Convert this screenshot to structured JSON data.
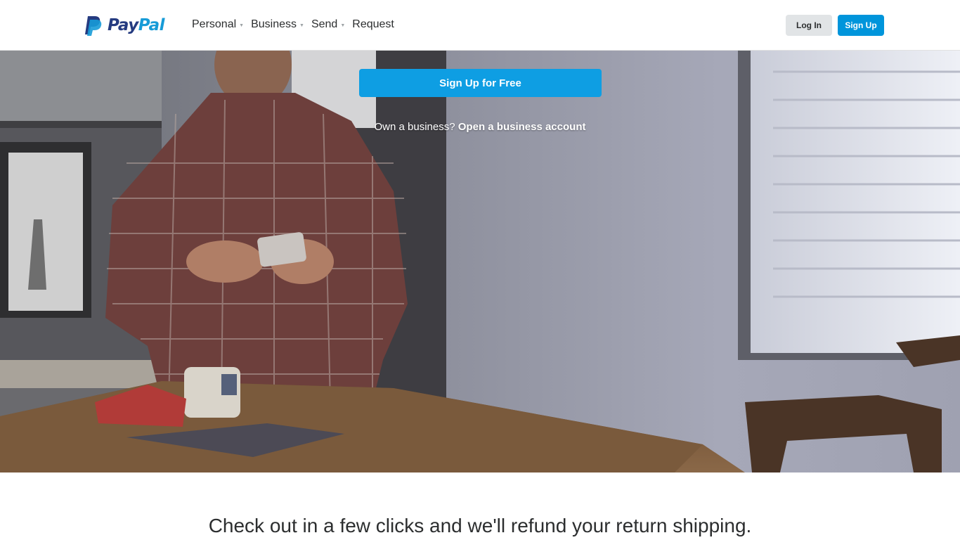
{
  "header": {
    "brand": {
      "pay": "Pay",
      "pal": "Pal"
    },
    "nav": [
      {
        "label": "Personal",
        "dropdown": true
      },
      {
        "label": "Business",
        "dropdown": true
      },
      {
        "label": "Send",
        "dropdown": true
      },
      {
        "label": "Request",
        "dropdown": false
      }
    ],
    "login_label": "Log In",
    "signup_label": "Sign Up"
  },
  "hero": {
    "cta_label": "Sign Up for Free",
    "business_prompt": "Own a business?",
    "business_link": "Open a business account"
  },
  "main": {
    "headline": "Check out in a few clicks and we'll refund your return shipping."
  },
  "colors": {
    "brand_dark": "#253b80",
    "brand_light": "#179bd7",
    "button_blue": "#0095db",
    "cta_blue": "#0e9ee3",
    "login_gray": "#e1e4e6"
  },
  "icons": [
    "paypal-logo-icon",
    "chevron-down-icon"
  ]
}
